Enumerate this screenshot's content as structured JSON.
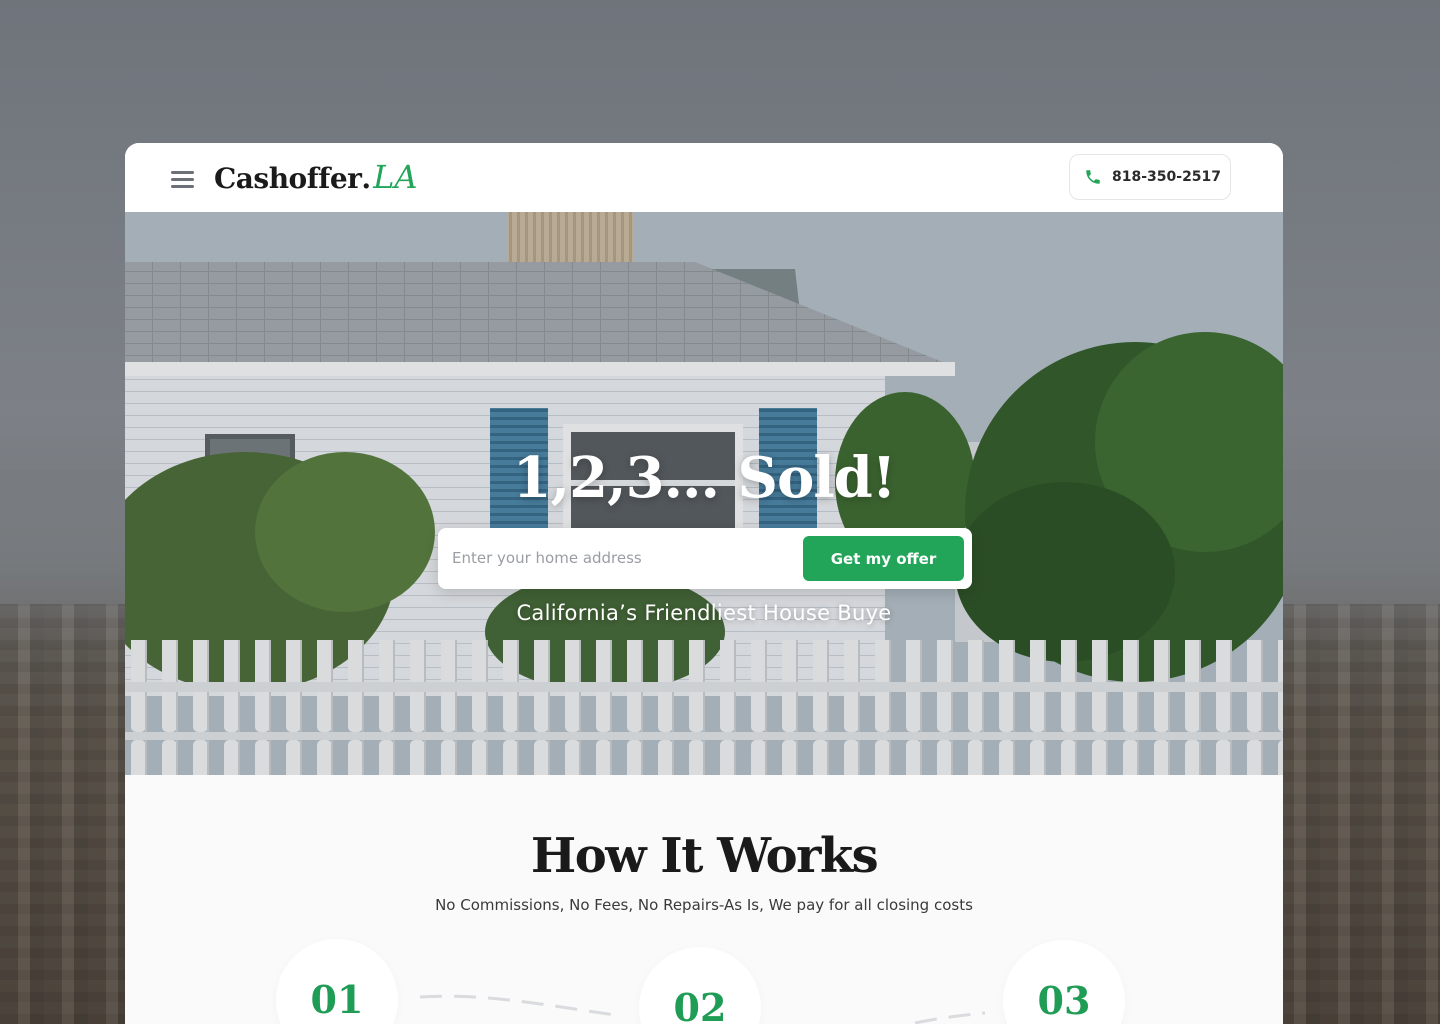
{
  "header": {
    "logo_word": "Cashoffer",
    "logo_dot": ".",
    "logo_accent": "LA",
    "phone": "818-350-2517"
  },
  "hero": {
    "title": "1,2,3... Sold!",
    "search_placeholder": "Enter your home address",
    "cta_label": "Get my offer",
    "subtitle": "California’s Friendliest House Buye"
  },
  "how_it_works": {
    "title": "How It Works",
    "subtitle": "No Commissions, No Fees, No Repairs-As Is, We pay for all closing costs",
    "steps": [
      {
        "number": "01"
      },
      {
        "number": "02"
      },
      {
        "number": "03"
      }
    ]
  },
  "colors": {
    "accent": "#22a559",
    "step_number": "#1f9c55",
    "heading": "#1a1a1a"
  },
  "icons": {
    "menu": "hamburger-menu-icon",
    "phone": "phone-icon"
  }
}
